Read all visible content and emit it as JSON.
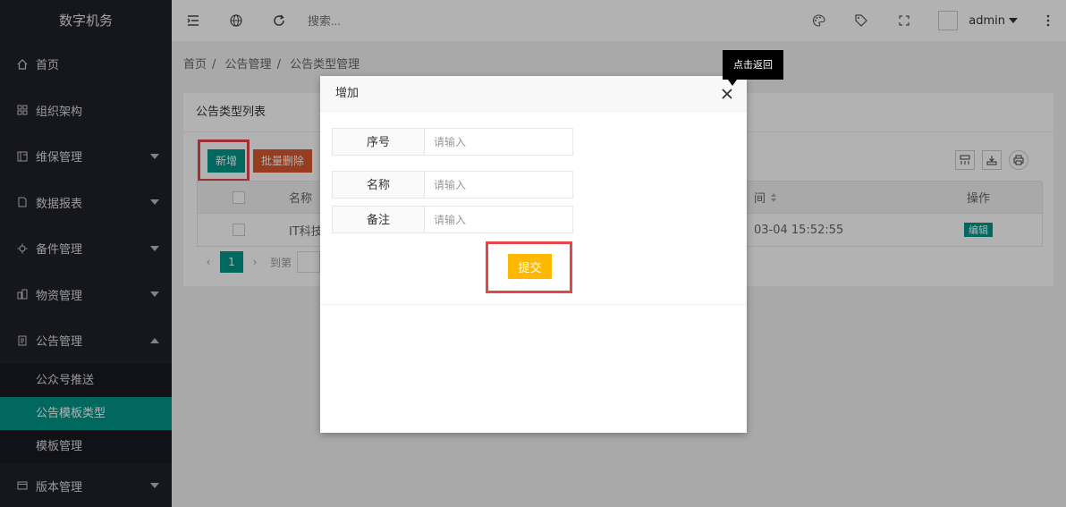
{
  "app": {
    "title": "数字机务"
  },
  "sidebar": {
    "items": [
      {
        "label": "首页",
        "icon": "home-icon"
      },
      {
        "label": "组织架构",
        "icon": "org-icon"
      },
      {
        "label": "维保管理",
        "icon": "maintenance-icon"
      },
      {
        "label": "数据报表",
        "icon": "report-icon"
      },
      {
        "label": "备件管理",
        "icon": "parts-icon"
      },
      {
        "label": "物资管理",
        "icon": "materials-icon"
      },
      {
        "label": "公告管理",
        "icon": "notice-icon"
      }
    ],
    "notice_sub": [
      {
        "label": "公众号推送"
      },
      {
        "label": "公告模板类型"
      },
      {
        "label": "模板管理"
      }
    ],
    "last_item": {
      "label": "版本管理",
      "icon": "version-icon"
    }
  },
  "header": {
    "search_placeholder": "搜索...",
    "user": "admin"
  },
  "breadcrumb": [
    "首页",
    "公告管理",
    "公告类型管理"
  ],
  "card": {
    "title": "公告类型列表",
    "add_label": "新增",
    "batch_delete_label": "批量删除",
    "columns": [
      "名称",
      "间",
      "操作"
    ],
    "rows": [
      {
        "name": "IT科技",
        "time": "03-04 15:52:55",
        "action": "编辑"
      }
    ],
    "pager": {
      "current": "1",
      "goto_label": "到第"
    }
  },
  "modal": {
    "title": "增加",
    "fields": [
      {
        "label": "序号",
        "placeholder": "请输入"
      },
      {
        "label": "名称",
        "placeholder": "请输入"
      },
      {
        "label": "备注",
        "placeholder": "请输入"
      }
    ],
    "submit_label": "提交"
  },
  "tooltip": {
    "text": "点击返回"
  },
  "colors": {
    "sidebar_bg": "#20222a",
    "accent": "#009688",
    "danger": "#d8562b",
    "warning": "#ffb800",
    "highlight": "#e6454c"
  }
}
